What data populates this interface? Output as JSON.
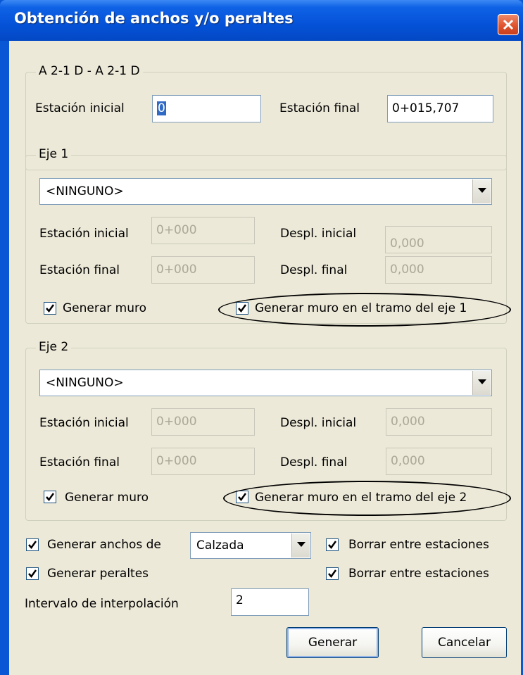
{
  "window": {
    "title": "Obtención de anchos y/o peraltes"
  },
  "top_group": {
    "title": "A 2-1 D - A 2-1 D",
    "estacion_inicial_label": "Estación inicial",
    "estacion_inicial_value": "0",
    "estacion_final_label": "Estación final",
    "estacion_final_value": "0+015,707"
  },
  "eje1": {
    "title": "Eje 1",
    "combo_value": "<NINGUNO>",
    "estacion_inicial_label": "Estación inicial",
    "estacion_inicial_value": "0+000",
    "despl_inicial_label": "Despl. inicial",
    "despl_inicial_value": "0,000",
    "estacion_final_label": "Estación final",
    "estacion_final_value": "0+000",
    "despl_final_label": "Despl. final",
    "despl_final_value": "0,000",
    "generar_muro_label": "Generar muro",
    "generar_muro_tramo_label": "Generar muro en el tramo del eje 1"
  },
  "eje2": {
    "title": "Eje 2",
    "combo_value": "<NINGUNO>",
    "estacion_inicial_label": "Estación inicial",
    "estacion_inicial_value": "0+000",
    "despl_inicial_label": "Despl. inicial",
    "despl_inicial_value": "0,000",
    "estacion_final_label": "Estación final",
    "estacion_final_value": "0+000",
    "despl_final_label": "Despl. final",
    "despl_final_value": "0,000",
    "generar_muro_label": "Generar muro",
    "generar_muro_tramo_label": "Generar muro en el tramo del eje 2"
  },
  "bottom": {
    "generar_anchos_label": "Generar anchos de",
    "anchos_combo_value": "Calzada",
    "borrar_1_label": "Borrar entre estaciones",
    "generar_peraltes_label": "Generar peraltes",
    "borrar_2_label": "Borrar entre estaciones",
    "intervalo_label": "Intervalo de interpolación",
    "intervalo_value": "2"
  },
  "buttons": {
    "generar": "Generar",
    "cancelar": "Cancelar"
  },
  "colors": {
    "title_bar": "#0552d8",
    "dialog_bg": "#ece9d8",
    "close_button": "#e0542e",
    "field_border": "#7f9db9"
  }
}
